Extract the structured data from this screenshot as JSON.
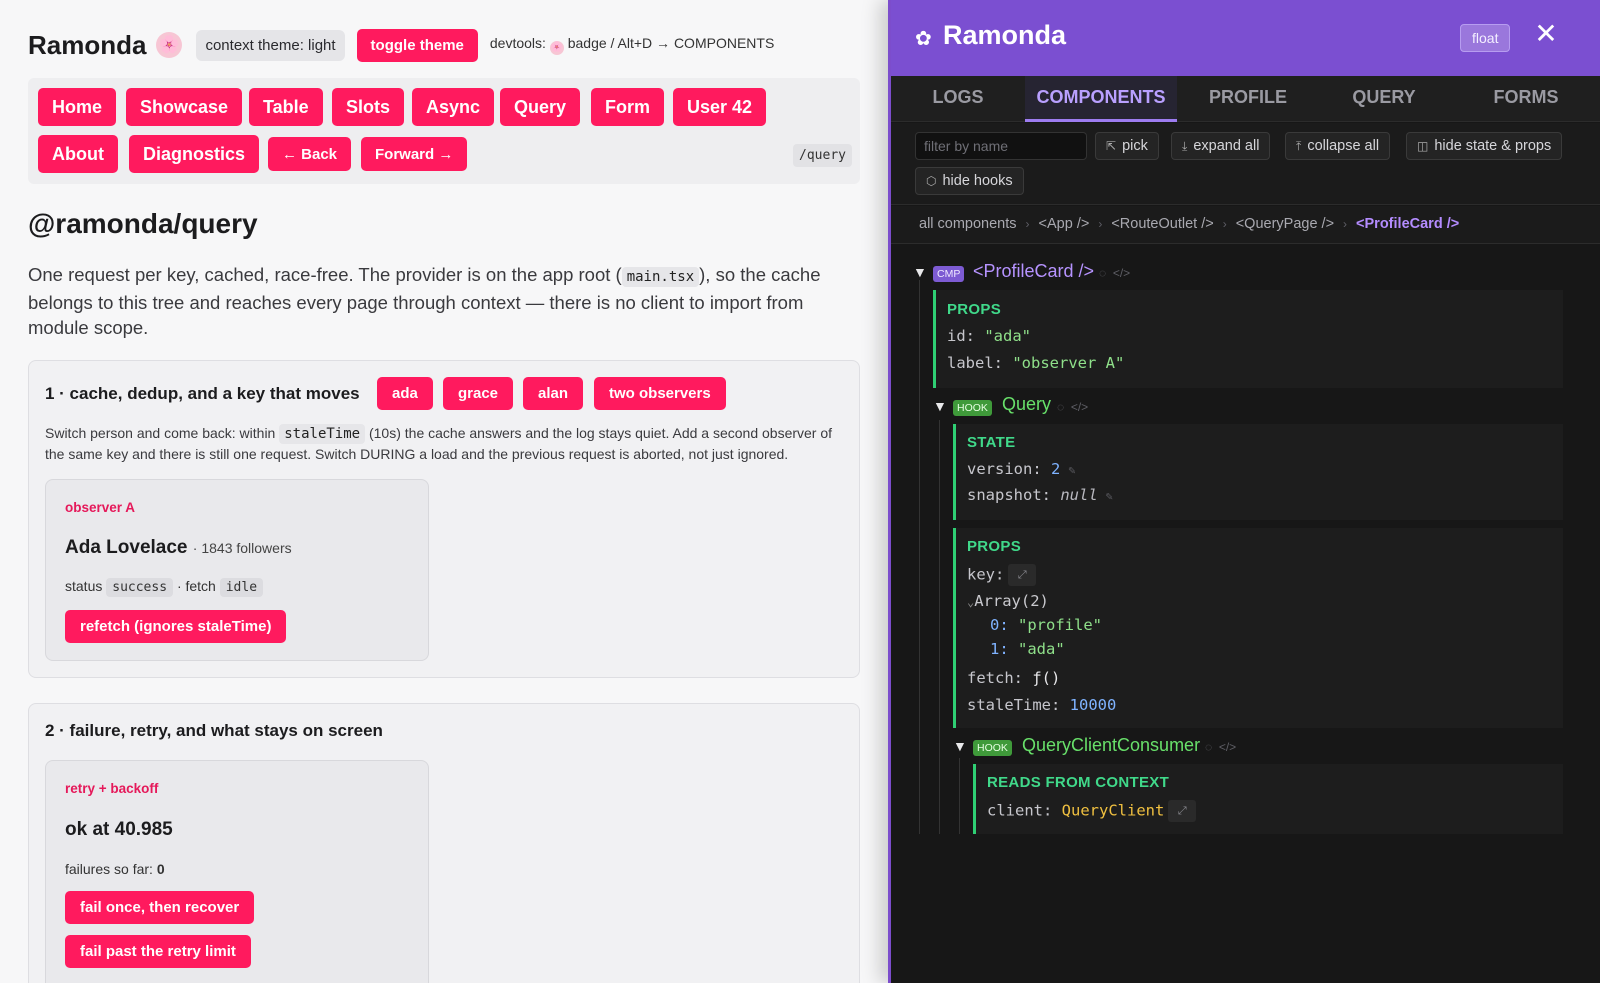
{
  "app": {
    "brand": "Ramonda",
    "logo_icon": "🌸",
    "context_chip": "context theme: light",
    "toggle_theme": "toggle theme",
    "devtools_hint_prefix": "devtools:",
    "devtools_hint_suffix": "badge / Alt+D → COMPONENTS",
    "nav": {
      "row1": [
        "Home",
        "Showcase",
        "Table",
        "Slots",
        "Async",
        "Query",
        "Form",
        "User 42"
      ],
      "row2": [
        "About",
        "Diagnostics"
      ],
      "back": "← Back",
      "forward": "Forward →",
      "route": "/query"
    },
    "page_title": "@ramonda/query",
    "lead_before": "One request per key, cached, race-free. The provider is on the app root (",
    "lead_code": "main.tsx",
    "lead_after": "), so the cache belongs to this tree and reaches every page through context — there is no client to import from module scope.",
    "section1": {
      "title": "1 · cache, dedup, and a key that moves",
      "chips": [
        "ada",
        "grace",
        "alan",
        "two observers"
      ],
      "desc_before": "Switch person and come back: within ",
      "desc_code": "staleTime",
      "desc_after": " (10s) the cache answers and the log stays quiet. Add a second observer of the same key and there is still one request. Switch DURING a load and the previous request is aborted, not just ignored.",
      "observer": {
        "label": "observer A",
        "name": "Ada Lovelace",
        "followers": "· 1843 followers",
        "status_label": "status",
        "status_value": "success",
        "fetch_label": "· fetch",
        "fetch_value": "idle",
        "refetch_button": "refetch (ignores staleTime)"
      }
    },
    "section2": {
      "title": "2 · failure, retry, and what stays on screen",
      "label": "retry + backoff",
      "result": "ok at 40.985",
      "failures_label": "failures so far:",
      "failures_value": "0",
      "btn_fail_once": "fail once, then recover",
      "btn_fail_past": "fail past the retry limit"
    }
  },
  "devtools": {
    "title": "Ramonda",
    "star_icon": "✿",
    "float_button": "float",
    "close_icon": "✕",
    "tabs": [
      "LOGS",
      "COMPONENTS",
      "PROFILE",
      "QUERY",
      "FORMS"
    ],
    "active_tab": "COMPONENTS",
    "filter_placeholder": "filter by name",
    "buttons": {
      "pick": "pick",
      "expand_all": "expand all",
      "collapse_all": "collapse all",
      "hide_state_props": "hide state & props",
      "hide_hooks": "hide hooks"
    },
    "breadcrumbs": [
      "all components",
      "<App />",
      "<RouteOutlet />",
      "<QueryPage />",
      "<ProfileCard />"
    ],
    "tree": {
      "root": {
        "badge": "CMP",
        "name": "<ProfileCard />",
        "props_label": "PROPS",
        "props": [
          {
            "key": "id:",
            "value": "\"ada\""
          },
          {
            "key": "label:",
            "value": "\"observer A\""
          }
        ]
      },
      "hook_query": {
        "badge": "HOOK",
        "name": "Query",
        "state_label": "STATE",
        "state": [
          {
            "key": "version:",
            "value": "2"
          },
          {
            "key": "snapshot:",
            "value": "null"
          }
        ],
        "props_label": "PROPS",
        "key_label": "key:",
        "array_label": "Array(2)",
        "array_items": [
          {
            "index": "0:",
            "value": "\"profile\""
          },
          {
            "index": "1:",
            "value": "\"ada\""
          }
        ],
        "fetch_key": "fetch:",
        "fetch_value": "ƒ()",
        "stale_key": "staleTime:",
        "stale_value": "10000"
      },
      "hook_consumer": {
        "badge": "HOOK",
        "name": "QueryClientConsumer",
        "reads_label": "READS FROM CONTEXT",
        "client_key": "client:",
        "client_value": "QueryClient"
      }
    }
  },
  "colors": {
    "accent": "#ff1a5e",
    "devtools_header": "#7b4fd1",
    "devtools_bg": "#171717",
    "panel_border": "#2fcf74",
    "cmp_name": "#b693ff",
    "hook_name": "#68e06a"
  }
}
